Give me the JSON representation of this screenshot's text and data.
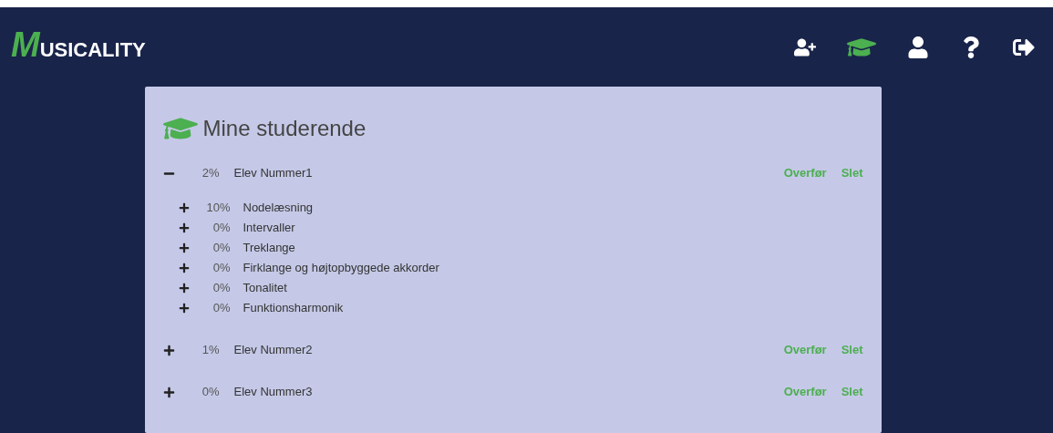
{
  "logo": {
    "initial": "M",
    "rest": "USICALITY"
  },
  "nav": [
    {
      "kind": "add-user",
      "selected": false
    },
    {
      "kind": "students",
      "selected": true
    },
    {
      "kind": "profile",
      "selected": false
    },
    {
      "kind": "help",
      "selected": false
    },
    {
      "kind": "logout",
      "selected": false
    }
  ],
  "panel": {
    "title": "Mine studerende",
    "students": [
      {
        "percent": "2%",
        "name": "Elev Nummer1",
        "expanded": true,
        "actions": [
          "Overfør",
          "Slet"
        ],
        "children": [
          {
            "percent": "10%",
            "name": "Nodelæsning",
            "expanded": false
          },
          {
            "percent": "0%",
            "name": "Intervaller",
            "expanded": false
          },
          {
            "percent": "0%",
            "name": "Treklange",
            "expanded": false
          },
          {
            "percent": "0%",
            "name": "Firklange og højtopbyggede akkorder",
            "expanded": false
          },
          {
            "percent": "0%",
            "name": "Tonalitet",
            "expanded": false
          },
          {
            "percent": "0%",
            "name": "Funktionsharmonik",
            "expanded": false
          }
        ]
      },
      {
        "percent": "1%",
        "name": "Elev Nummer2",
        "expanded": false,
        "actions": [
          "Overfør",
          "Slet"
        ]
      },
      {
        "percent": "0%",
        "name": "Elev Nummer3",
        "expanded": false,
        "actions": [
          "Overfør",
          "Slet"
        ]
      }
    ]
  }
}
